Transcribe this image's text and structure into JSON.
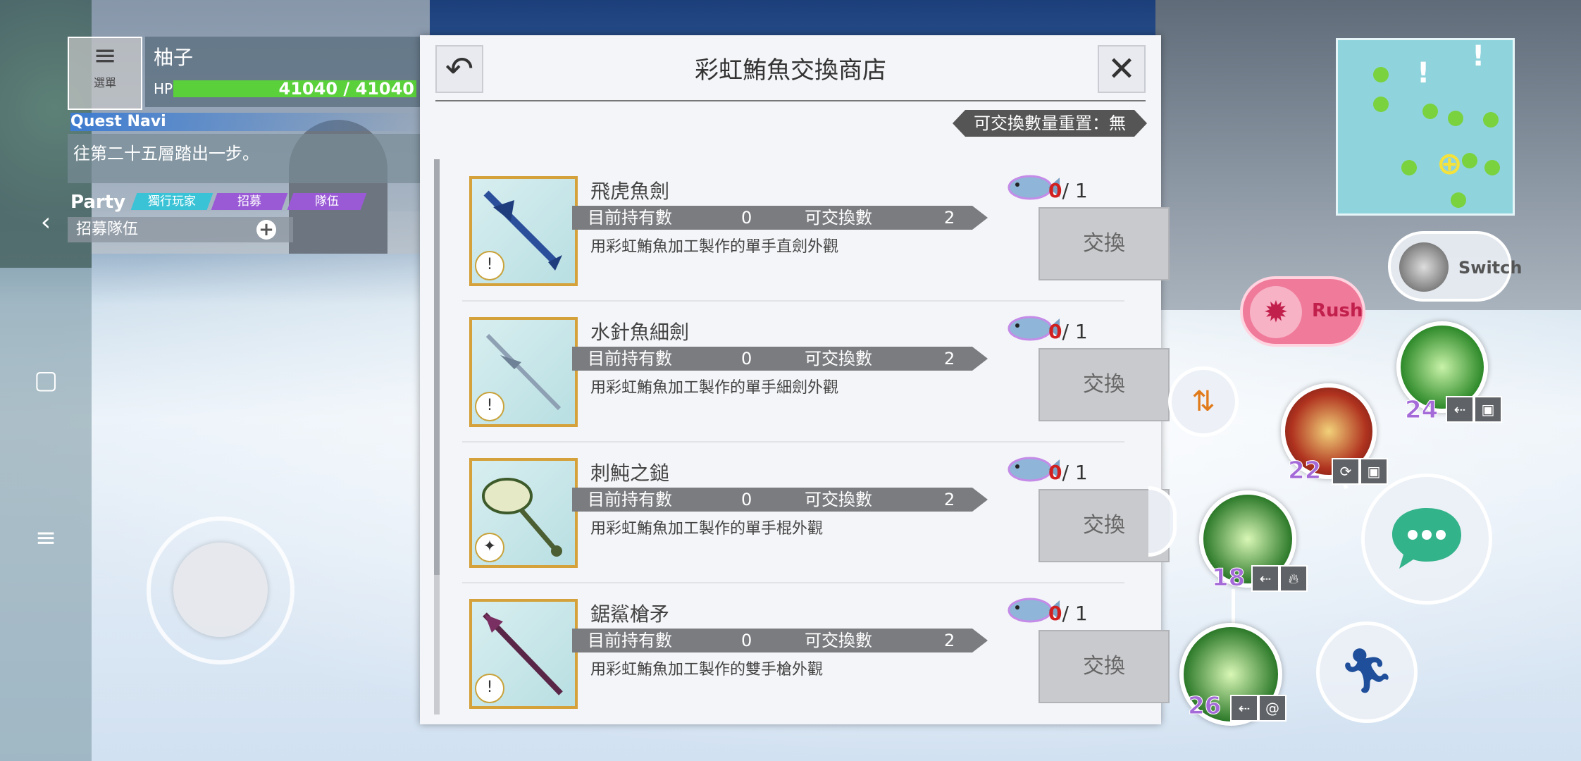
{
  "hud": {
    "menu_label": "選單",
    "player_name": "柚子",
    "hp_label": "HP",
    "hp_value": "41040 / 41040",
    "hp_fraction": 1.0,
    "quest_title": "Quest Navi",
    "quest_text": "往第二十五層踏出一步。",
    "party_label": "Party",
    "party_tabs": [
      "獨行玩家",
      "招募",
      "隊伍"
    ],
    "recruit_label": "招募隊伍"
  },
  "shop": {
    "title": "彩虹鮪魚交換商店",
    "reset_label": "可交換數量重置：無",
    "items": [
      {
        "name": "飛虎魚劍",
        "owned_label": "目前持有數",
        "owned": "0",
        "avail_label": "可交換數",
        "avail": "2",
        "desc": "用彩虹鮪魚加工製作的單手直劍外觀",
        "cost_have": "0",
        "cost_need": "/ 1",
        "button": "交換",
        "weapon_icon": "sword-icon"
      },
      {
        "name": "水針魚細劍",
        "owned_label": "目前持有數",
        "owned": "0",
        "avail_label": "可交換數",
        "avail": "2",
        "desc": "用彩虹鮪魚加工製作的單手細劍外觀",
        "cost_have": "0",
        "cost_need": "/ 1",
        "button": "交換",
        "weapon_icon": "rapier-icon"
      },
      {
        "name": "刺魨之鎚",
        "owned_label": "目前持有數",
        "owned": "0",
        "avail_label": "可交換數",
        "avail": "2",
        "desc": "用彩虹鮪魚加工製作的單手棍外觀",
        "cost_have": "0",
        "cost_need": "/ 1",
        "button": "交換",
        "weapon_icon": "mace-icon"
      },
      {
        "name": "鋸鯊槍矛",
        "owned_label": "目前持有數",
        "owned": "0",
        "avail_label": "可交換數",
        "avail": "2",
        "desc": "用彩虹鮪魚加工製作的雙手槍外觀",
        "cost_have": "0",
        "cost_need": "/ 1",
        "button": "交換",
        "weapon_icon": "spear-icon"
      }
    ]
  },
  "controls": {
    "switch_label": "Switch",
    "rush_label": "Rush",
    "skills": [
      {
        "level": "24"
      },
      {
        "level": "22"
      },
      {
        "level": "18"
      },
      {
        "level": "26"
      }
    ]
  },
  "colors": {
    "hp": "#5ad13a",
    "frame_gold": "#d4a13a",
    "cost_red": "#d12020",
    "rush_pink": "#f07a9a",
    "skill_purple": "#a46ad8"
  }
}
